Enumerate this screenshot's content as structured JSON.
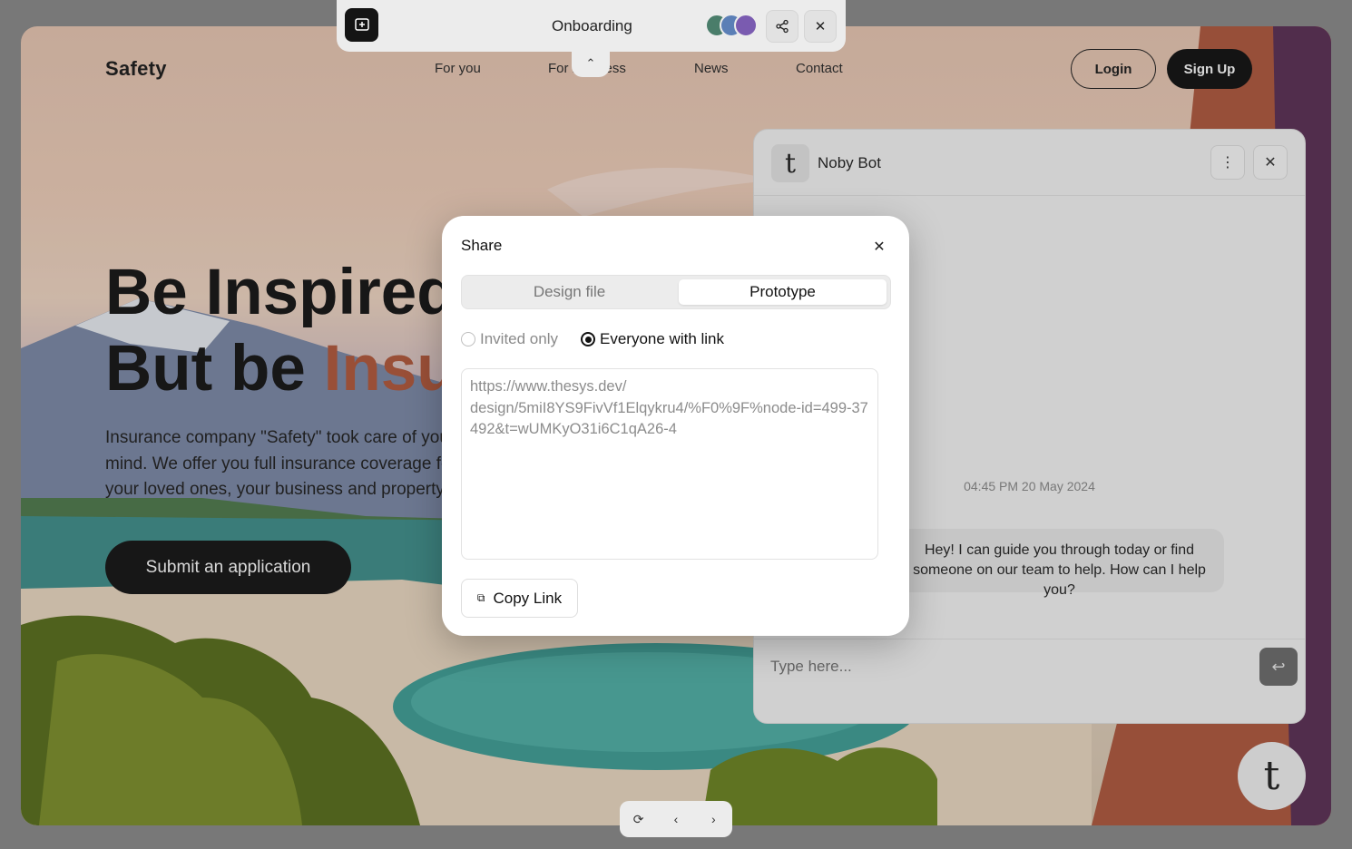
{
  "site": {
    "logo": "Safety",
    "nav": [
      "For you",
      "For business",
      "News",
      "Contact"
    ],
    "login": "Login",
    "signup": "Sign Up",
    "hero_line1": "Be Inspired",
    "hero_line2_plain": "But be ",
    "hero_line2_accent": "Insured",
    "hero_text": "Insurance company \"Safety\" took care of your peace of mind. We offer you full insurance coverage for you, your loved ones, your business and property.",
    "submit": "Submit an application"
  },
  "chat": {
    "bot_name": "Noby Bot",
    "avatar_letter": "t",
    "more_icon": "more-vertical-icon",
    "close_icon": "close-icon",
    "timestamp": "04:45 PM 20 May 2024",
    "message": "Hey! I can guide you through today or find someone on our team to help. How can I help you?",
    "input_placeholder": "Type here...",
    "send_icon": "enter-icon"
  },
  "fab_letter": "t",
  "toolbar": {
    "title": "Onboarding",
    "comment_icon": "comment-add-icon",
    "share_icon": "share-icon",
    "close_icon": "close-icon",
    "chevron_icon": "chevron-up-icon"
  },
  "bottom_controls": {
    "restart_icon": "restart-icon",
    "prev_icon": "chevron-left-icon",
    "next_icon": "chevron-right-icon"
  },
  "share_modal": {
    "title": "Share",
    "tabs": [
      "Design file",
      "Prototype"
    ],
    "active_tab": "Prototype",
    "radio_options": [
      "Invited only",
      "Everyone with link"
    ],
    "selected_option": "Everyone with link",
    "link": "https://www.thesys.dev/\ndesign/5miI8YS9FivVf1Elqykru4/%F0%9F%node-id=499-37492&t=wUMKyO31i6C1qA26-4",
    "copy_label": "Copy Link"
  },
  "colors": {
    "accent": "#b3583b",
    "dark": "#141414",
    "modal_bg": "#ffffff"
  }
}
